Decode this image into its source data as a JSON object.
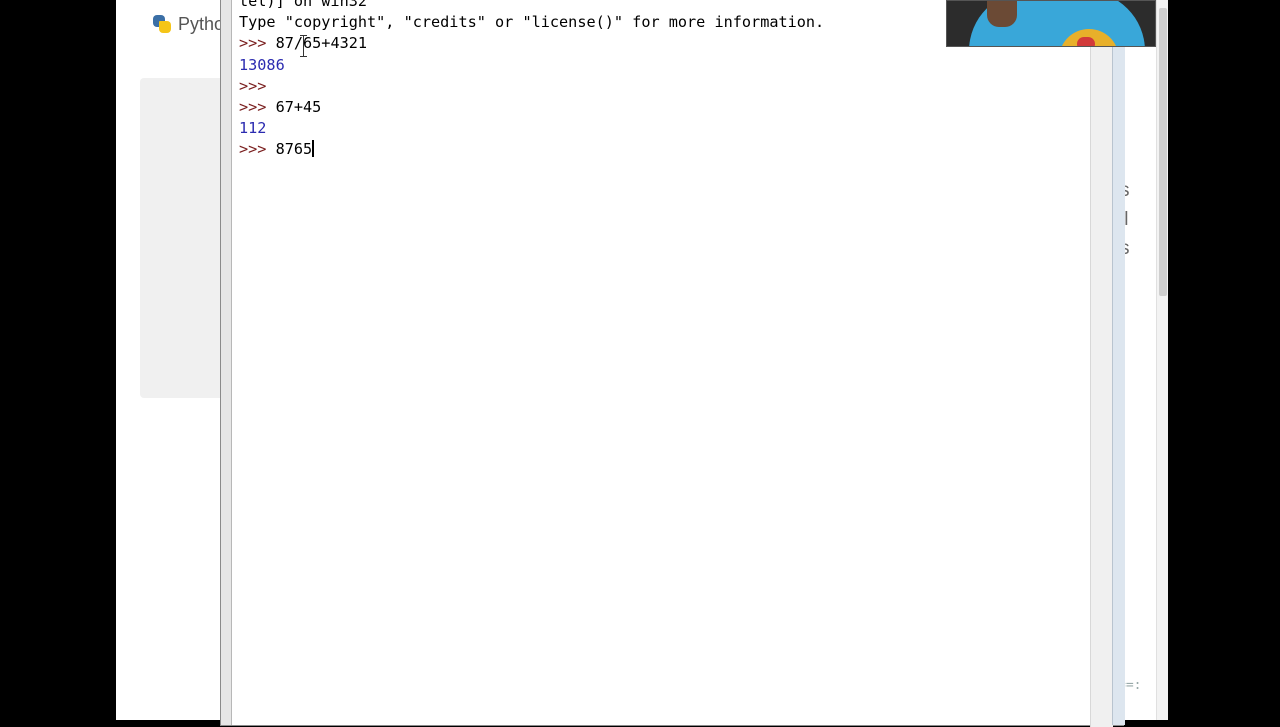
{
  "background_page": {
    "header_label": "Pytho",
    "side_text": [
      "s",
      "ll",
      "s"
    ],
    "bottom_fragment": "==:"
  },
  "shell": {
    "lines": [
      {
        "type": "text",
        "text": "tel)] on win32"
      },
      {
        "type": "text",
        "text": "Type \"copyright\", \"credits\" or \"license()\" for more information."
      },
      {
        "type": "input",
        "prompt": ">>> ",
        "text": "87/65+4321"
      },
      {
        "type": "output",
        "text": "13086"
      },
      {
        "type": "input",
        "prompt": ">>> ",
        "text": ""
      },
      {
        "type": "input",
        "prompt": ">>> ",
        "text": "67+45"
      },
      {
        "type": "output",
        "text": "112"
      },
      {
        "type": "input",
        "prompt": ">>> ",
        "text": "8765",
        "active": true
      }
    ]
  },
  "colors": {
    "prompt": "#7a1f1f",
    "output": "#2b2bb0",
    "text": "#000000"
  },
  "icons": {
    "python_logo": "python-logo-icon"
  }
}
